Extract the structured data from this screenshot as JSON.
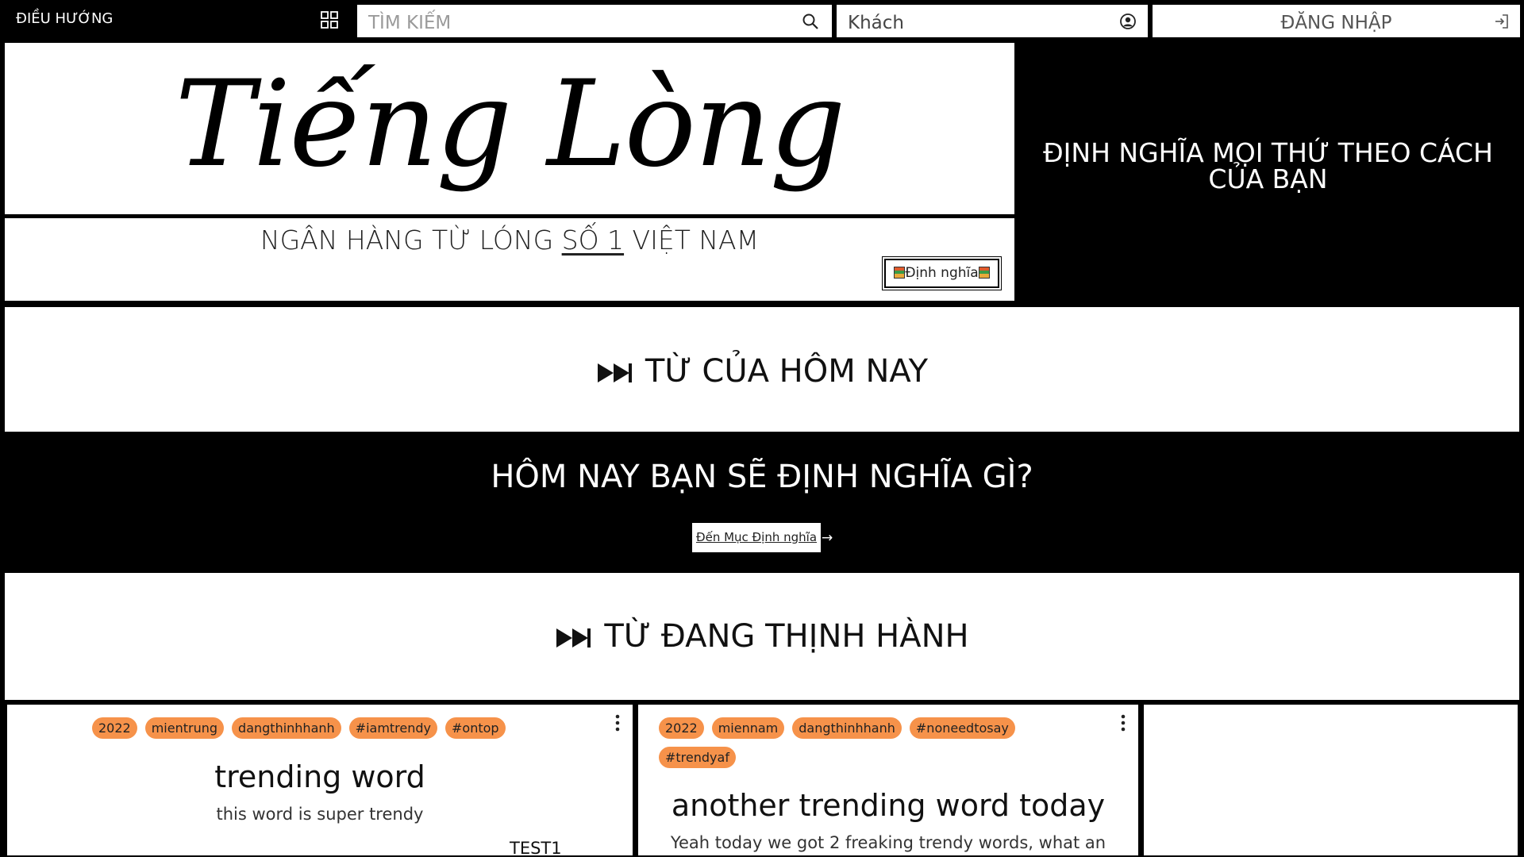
{
  "nav": {
    "menu_label": "ĐIỀU HƯỚNG",
    "search_placeholder": "TÌM KIẾM",
    "guest_label": "Khách",
    "login_label": "ĐĂNG NHẬP"
  },
  "hero": {
    "logo_text": "Tiếng Lòng",
    "slogan_before": "NGÂN HÀNG TỪ LÓNG ",
    "slogan_underlined": "SỐ 1",
    "slogan_after": " VIỆT NAM",
    "define_button_label": "Định nghĩa",
    "tagline": "ĐỊNH NGHĨA MỌI THỨ THEO CÁCH CỦA BẠN"
  },
  "sections": {
    "today_title": "TỪ CỦA HÔM NAY",
    "cta_title": "HÔM NAY BẠN SẼ ĐỊNH NGHĨA GÌ?",
    "cta_link": "Đến Mục Định nghĩa",
    "cta_arrow": "→",
    "trending_title": "TỪ ĐANG THỊNH HÀNH"
  },
  "cards": [
    {
      "tags": [
        "2022",
        "mientrung",
        "dangthinhhanh",
        "#iamtrendy",
        "#ontop"
      ],
      "word": "trending word",
      "description": "this word is super trendy",
      "author": "TEST1"
    },
    {
      "tags": [
        "2022",
        "miennam",
        "dangthinhhanh",
        "#noneedtosay",
        "#trendyaf"
      ],
      "word": "another trending word today",
      "description": "Yeah today we got 2 freaking trendy words, what an"
    }
  ],
  "colors": {
    "background": "#000000",
    "panel": "#ffffff",
    "tag": "#f6924a"
  },
  "icons": [
    "grid-icon",
    "search-icon",
    "user-circle-icon",
    "login-icon",
    "fast-forward-icon",
    "book-icon",
    "kebab-menu-icon"
  ]
}
